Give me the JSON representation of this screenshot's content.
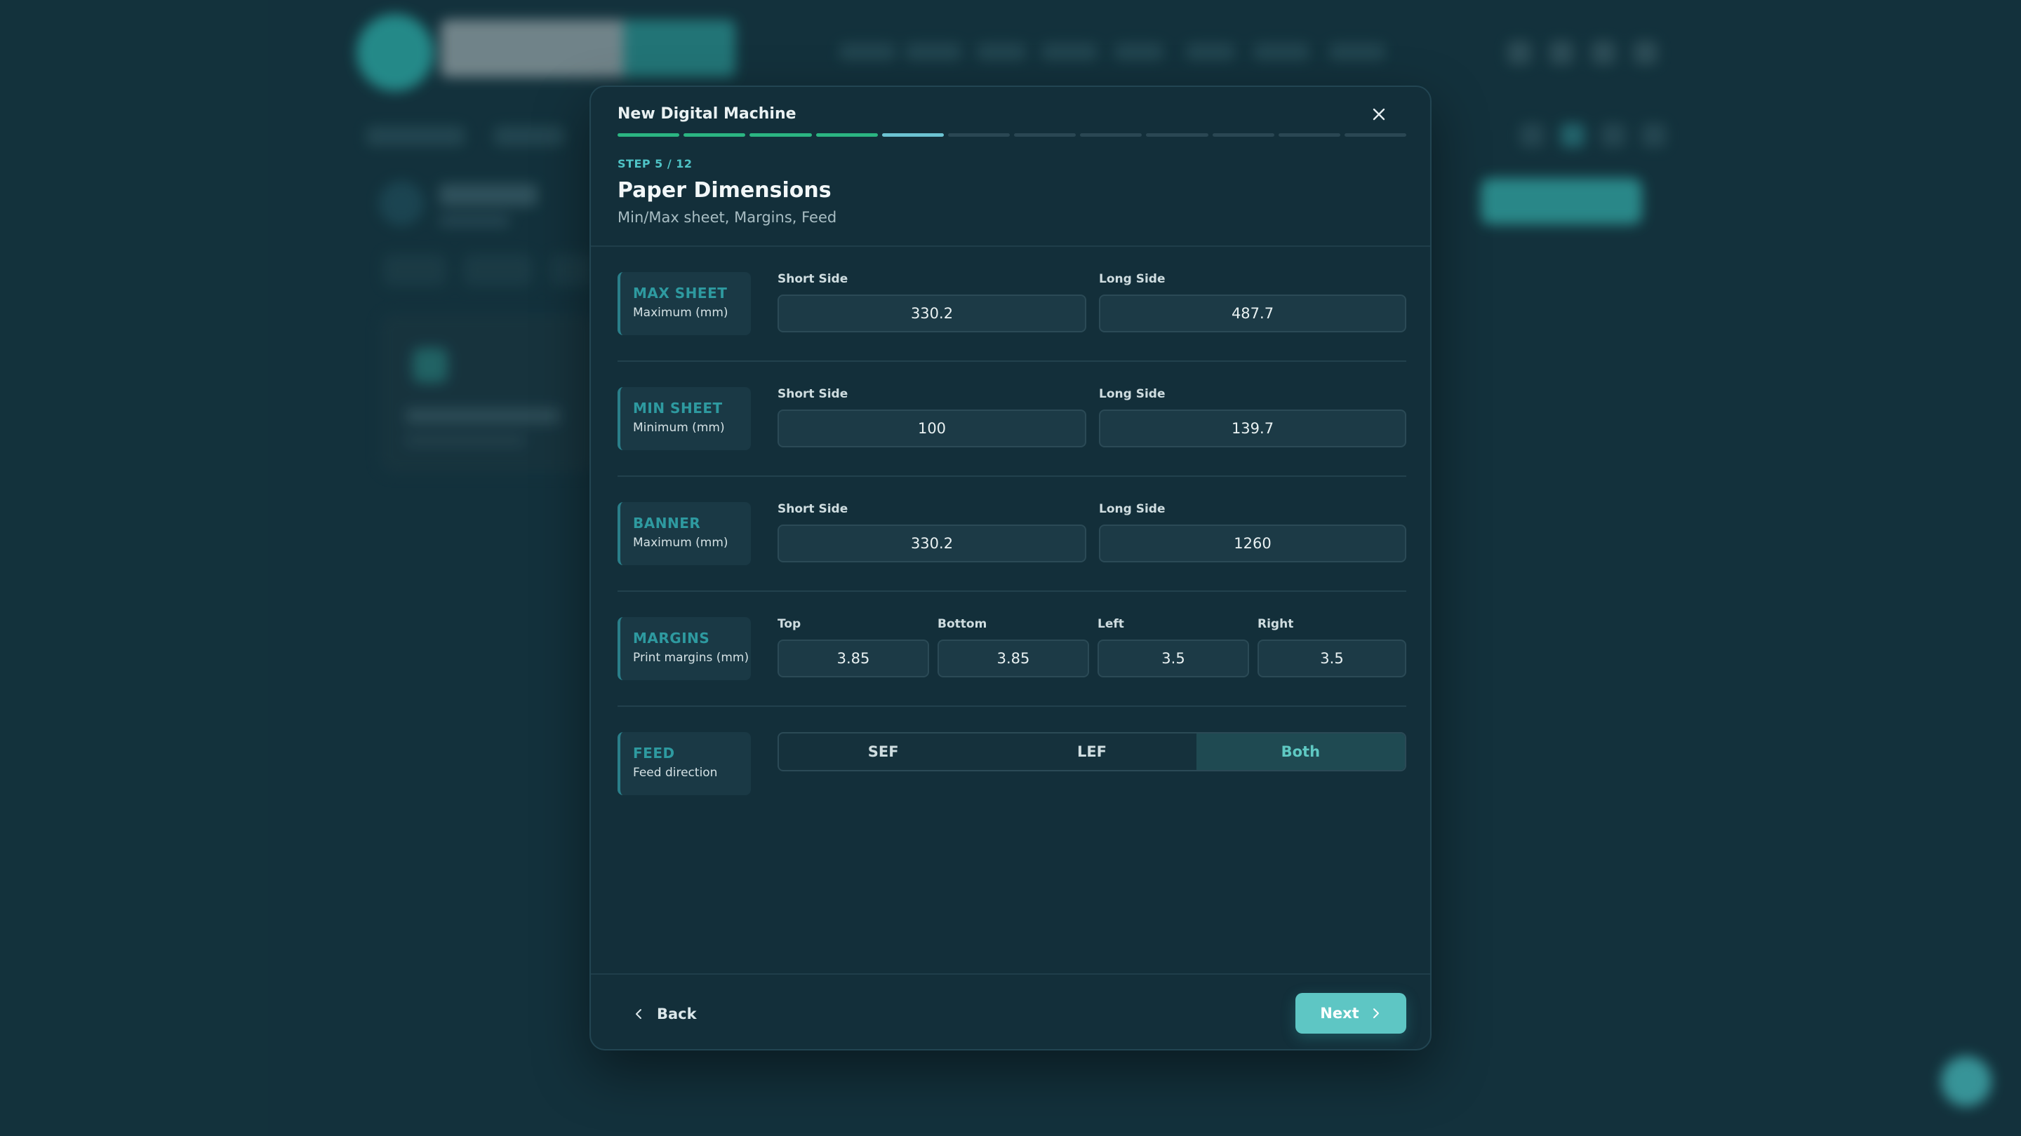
{
  "modal": {
    "title": "New Digital Machine",
    "step_label": "STEP 5 / 12",
    "heading": "Paper Dimensions",
    "subheading": "Min/Max sheet, Margins, Feed",
    "progress": {
      "current_step": 5,
      "total_steps": 12
    }
  },
  "sections": {
    "max_sheet": {
      "title": "MAX SHEET",
      "subtitle": "Maximum (mm)",
      "short_label": "Short Side",
      "short_value": "330.2",
      "long_label": "Long Side",
      "long_value": "487.7"
    },
    "min_sheet": {
      "title": "MIN SHEET",
      "subtitle": "Minimum (mm)",
      "short_label": "Short Side",
      "short_value": "100",
      "long_label": "Long Side",
      "long_value": "139.7"
    },
    "banner": {
      "title": "BANNER",
      "subtitle": "Maximum (mm)",
      "short_label": "Short Side",
      "short_value": "330.2",
      "long_label": "Long Side",
      "long_value": "1260"
    },
    "margins": {
      "title": "MARGINS",
      "subtitle": "Print margins (mm)",
      "top_label": "Top",
      "top_value": "3.85",
      "bottom_label": "Bottom",
      "bottom_value": "3.85",
      "left_label": "Left",
      "left_value": "3.5",
      "right_label": "Right",
      "right_value": "3.5"
    },
    "feed": {
      "title": "FEED",
      "subtitle": "Feed direction",
      "options": [
        "SEF",
        "LEF",
        "Both"
      ],
      "selected": "Both"
    }
  },
  "footer": {
    "back_label": "Back",
    "next_label": "Next"
  },
  "icons": {
    "close": "close-icon",
    "back": "chevron-left-icon",
    "next": "chevron-right-icon"
  },
  "colors": {
    "accent": "#5ec6c4",
    "progress_done": "#2bb582",
    "progress_current": "#6cc3d2",
    "section_title": "#2e9aa0"
  }
}
